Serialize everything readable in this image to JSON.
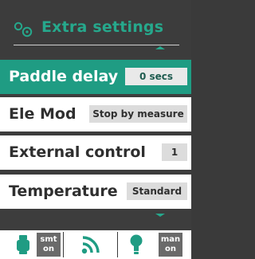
{
  "header": {
    "title": "Extra settings",
    "icon": "gear-icon",
    "accent_color": "#26a88c"
  },
  "settings": [
    {
      "label": "Paddle delay",
      "value": "0 secs",
      "active": true
    },
    {
      "label": "Ele Mod",
      "value": "Stop by measure",
      "active": false
    },
    {
      "label": "External control",
      "value": "1",
      "active": false
    },
    {
      "label": "Temperature",
      "value": "Standard",
      "active": false
    }
  ],
  "status_bar": {
    "left": {
      "icon": "device-icon",
      "line1": "smt",
      "line2": "on"
    },
    "middle": {
      "icon": "signal-icon"
    },
    "right": {
      "icon": "lightbulb-icon",
      "line1": "man",
      "line2": "on"
    }
  },
  "colors": {
    "active_row": "#1f9c83",
    "icon_teal": "#1f9c83",
    "pill_gray": "#6a6a6a"
  }
}
